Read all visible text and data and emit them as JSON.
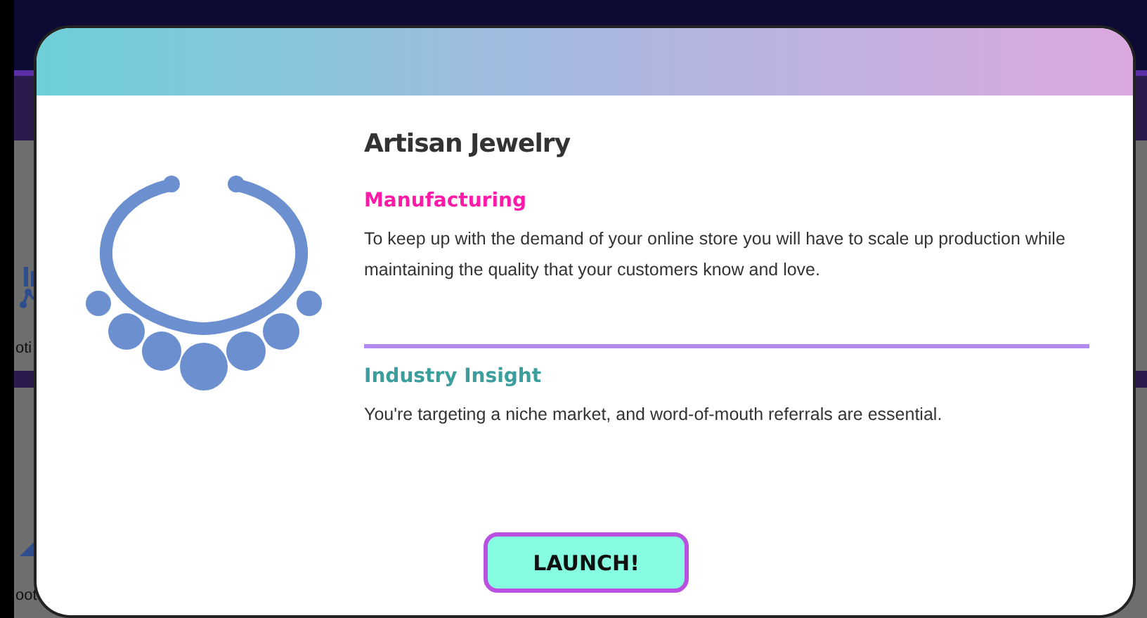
{
  "background": {
    "tiles": [
      {
        "label": "oti"
      },
      {
        "label": "oot"
      }
    ]
  },
  "modal": {
    "title": "Artisan Jewelry",
    "sections": [
      {
        "kind": "challenge",
        "heading": "Manufacturing",
        "text": "To keep up with the demand of your online store you will have to scale up production while maintaining the quality that your customers know and love."
      },
      {
        "kind": "insight",
        "heading": "Industry Insight",
        "text": "You're targeting a niche market, and word-of-mouth referrals are essential."
      }
    ],
    "button": "LAUNCH!"
  }
}
